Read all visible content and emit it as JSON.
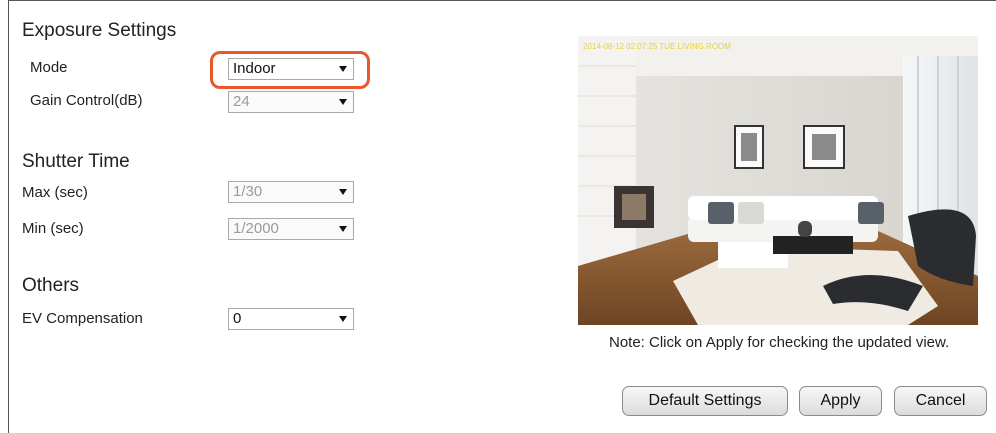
{
  "exposure": {
    "title": "Exposure Settings",
    "mode": {
      "label": "Mode",
      "value": "Indoor",
      "highlighted": true
    },
    "gain": {
      "label": "Gain Control(dB)",
      "value": "24",
      "enabled": false
    }
  },
  "shutter": {
    "title": "Shutter Time",
    "max": {
      "label": "Max (sec)",
      "value": "1/30",
      "enabled": false
    },
    "min": {
      "label": "Min (sec)",
      "value": "1/2000",
      "enabled": false
    }
  },
  "others": {
    "title": "Others",
    "ev": {
      "label": "EV Compensation",
      "value": "0",
      "enabled": true
    }
  },
  "preview": {
    "timestamp": "2014-08-12 02:07:25 TUE  LIVING ROOM",
    "note": "Note: Click on Apply for checking the updated view."
  },
  "buttons": {
    "default_label": "Default Settings",
    "apply_label": "Apply",
    "cancel_label": "Cancel"
  },
  "colors": {
    "highlight": "#e8582c",
    "timestamp": "#e6d23a"
  }
}
